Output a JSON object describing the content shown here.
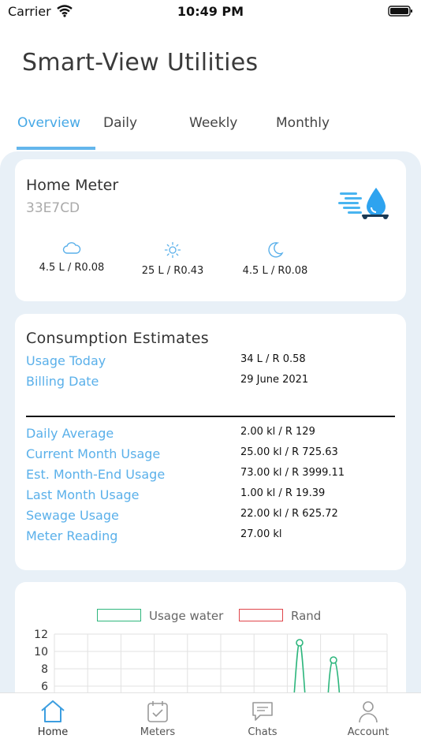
{
  "status_bar": {
    "carrier": "Carrier",
    "time": "10:49 PM"
  },
  "app_title": "Smart-View Utilities",
  "tabs": [
    {
      "label": "Overview",
      "active": true
    },
    {
      "label": "Daily",
      "active": false
    },
    {
      "label": "Weekly",
      "active": false
    },
    {
      "label": "Monthly",
      "active": false
    }
  ],
  "meter": {
    "name": "Home Meter",
    "id": "33E7CD",
    "periods": [
      {
        "icon": "cloud-icon",
        "value": "4.5 L / R0.08"
      },
      {
        "icon": "sun-icon",
        "value": "25 L / R0.43"
      },
      {
        "icon": "moon-icon",
        "value": "4.5 L / R0.08"
      }
    ]
  },
  "consumption": {
    "title": "Consumption Estimates",
    "top_rows": [
      {
        "label": "Usage Today",
        "value": "34 L / R 0.58"
      },
      {
        "label": "Billing Date",
        "value": "29 June 2021"
      }
    ],
    "rows": [
      {
        "label": "Daily Average",
        "value": "2.00 kl / R 129"
      },
      {
        "label": "Current Month Usage",
        "value": "25.00 kl / R 725.63"
      },
      {
        "label": "Est. Month-End Usage",
        "value": "73.00 kl / R 3999.11"
      },
      {
        "label": "Last Month Usage",
        "value": "1.00 kl / R 19.39"
      },
      {
        "label": "Sewage Usage",
        "value": "22.00 kl / R 625.72"
      },
      {
        "label": "Meter Reading",
        "value": "27.00 kl"
      }
    ]
  },
  "chart_data": {
    "type": "line",
    "legend": [
      {
        "name": "Usage water",
        "color": "#2eb67d"
      },
      {
        "name": "Rand",
        "color": "#e0454a"
      }
    ],
    "y_ticks": [
      "12",
      "10",
      "8",
      "6"
    ],
    "ylim_visible": [
      6,
      12
    ],
    "series": [
      {
        "name": "Usage water",
        "color": "#2eb67d",
        "peaks": [
          11,
          9
        ]
      }
    ]
  },
  "bottom_nav": [
    {
      "label": "Home",
      "icon": "home-icon",
      "active": true
    },
    {
      "label": "Meters",
      "icon": "calendar-check-icon",
      "active": false
    },
    {
      "label": "Chats",
      "icon": "chat-icon",
      "active": false
    },
    {
      "label": "Account",
      "icon": "user-icon",
      "active": false
    }
  ],
  "colors": {
    "accent": "#45a8e6",
    "background_panel": "#e8f0f7",
    "text_label": "#5ab0ea"
  }
}
